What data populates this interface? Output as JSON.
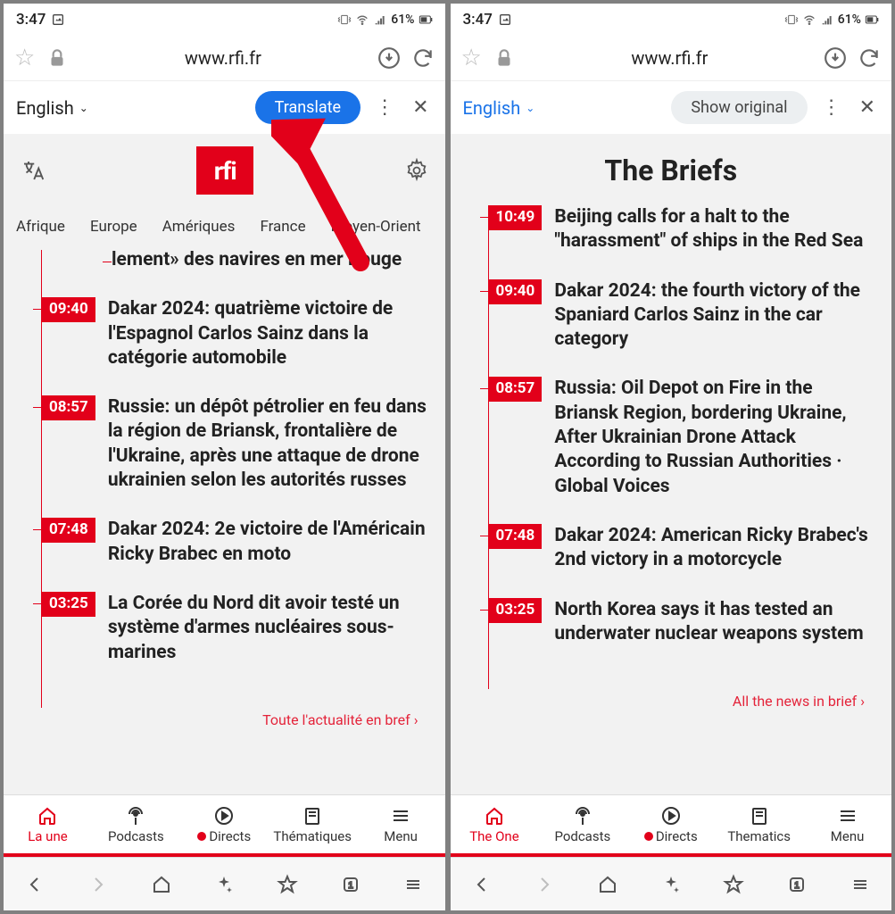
{
  "status": {
    "time": "3:47",
    "battery": "61%"
  },
  "url": "www.rfi.fr",
  "translate_bar": {
    "language": "English",
    "translate_label": "Translate",
    "show_original_label": "Show original"
  },
  "left": {
    "nav": [
      "Afrique",
      "Europe",
      "Amériques",
      "France",
      "Moyen-Orient"
    ],
    "partial_headline": "lement» des navires en mer Rouge",
    "items": [
      {
        "time": "09:40",
        "headline": "Dakar 2024: quatrième victoire de l'Espagnol Carlos Sainz dans la catégorie automobile"
      },
      {
        "time": "08:57",
        "headline": "Russie: un dépôt pétrolier en feu dans la région de Briansk, frontalière de l'Ukraine, après une attaque de drone ukrainien selon les autorités russes"
      },
      {
        "time": "07:48",
        "headline": "Dakar 2024: 2e victoire de l'Américain Ricky Brabec en moto"
      },
      {
        "time": "03:25",
        "headline": "La Corée du Nord dit avoir testé un système d'armes nucléaires sous-marines"
      }
    ],
    "more": "Toute l'actualité en bref",
    "bottom": [
      "La une",
      "Podcasts",
      "Directs",
      "Thématiques",
      "Menu"
    ]
  },
  "right": {
    "title": "The Briefs",
    "items": [
      {
        "time": "10:49",
        "headline": "Beijing calls for a halt to the \"harassment\" of ships in the Red Sea"
      },
      {
        "time": "09:40",
        "headline": "Dakar 2024: the fourth victory of the Spaniard Carlos Sainz in the car category"
      },
      {
        "time": "08:57",
        "headline": "Russia: Oil Depot on Fire in the Briansk Region, bordering Ukraine, After Ukrainian Drone Attack According to Russian Authorities · Global Voices"
      },
      {
        "time": "07:48",
        "headline": "Dakar 2024: American Ricky Brabec's 2nd victory in a motorcycle"
      },
      {
        "time": "03:25",
        "headline": "North Korea says it has tested an underwater nuclear weapons system"
      }
    ],
    "more": "All the news in brief",
    "bottom": [
      "The One",
      "Podcasts",
      "Directs",
      "Thematics",
      "Menu"
    ]
  },
  "logo_text": "rfi"
}
